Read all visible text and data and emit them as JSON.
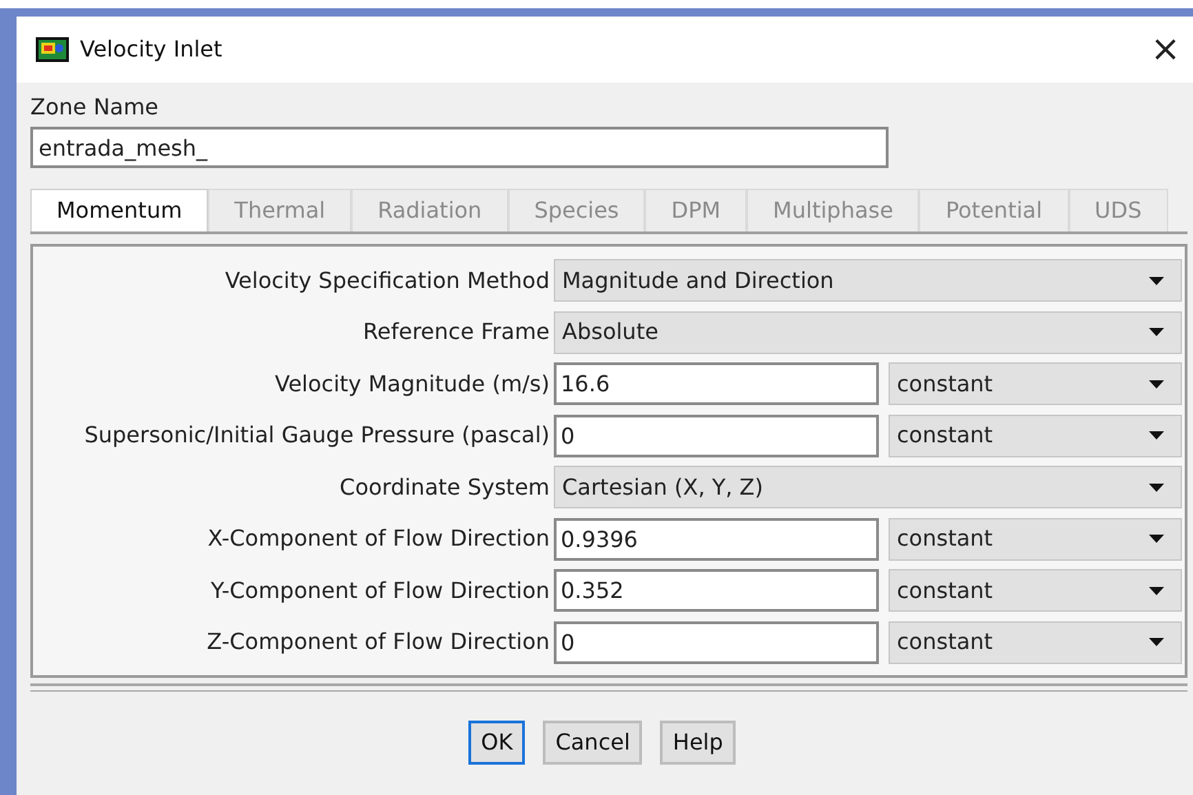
{
  "window": {
    "title": "Velocity Inlet",
    "close": "×"
  },
  "zone_name": {
    "label": "Zone Name",
    "value": "entrada_mesh_"
  },
  "tabs": [
    {
      "label": "Momentum",
      "selected": true,
      "disabled": false
    },
    {
      "label": "Thermal",
      "selected": false,
      "disabled": true
    },
    {
      "label": "Radiation",
      "selected": false,
      "disabled": true
    },
    {
      "label": "Species",
      "selected": false,
      "disabled": true
    },
    {
      "label": "DPM",
      "selected": false,
      "disabled": true
    },
    {
      "label": "Multiphase",
      "selected": false,
      "disabled": true
    },
    {
      "label": "Potential",
      "selected": false,
      "disabled": true
    },
    {
      "label": "UDS",
      "selected": false,
      "disabled": true
    }
  ],
  "rows": [
    {
      "kind": "dropdown",
      "label": "Velocity Specification Method",
      "value": "Magnitude and Direction"
    },
    {
      "kind": "dropdown",
      "label": "Reference Frame",
      "value": "Absolute"
    },
    {
      "kind": "input",
      "label": "Velocity Magnitude (m/s)",
      "value": "16.6",
      "method": "constant"
    },
    {
      "kind": "input",
      "label": "Supersonic/Initial Gauge Pressure (pascal)",
      "value": "0",
      "method": "constant"
    },
    {
      "kind": "dropdown",
      "label": "Coordinate System",
      "value": "Cartesian (X, Y, Z)"
    },
    {
      "kind": "input",
      "label": "X-Component of Flow Direction",
      "value": "0.9396",
      "method": "constant"
    },
    {
      "kind": "input",
      "label": "Y-Component of Flow Direction",
      "value": "0.352",
      "method": "constant"
    },
    {
      "kind": "input",
      "label": "Z-Component of Flow Direction",
      "value": "0",
      "method": "constant"
    }
  ],
  "buttons": [
    {
      "label": "OK",
      "focused": true
    },
    {
      "label": "Cancel",
      "focused": false
    },
    {
      "label": "Help",
      "focused": false
    }
  ]
}
